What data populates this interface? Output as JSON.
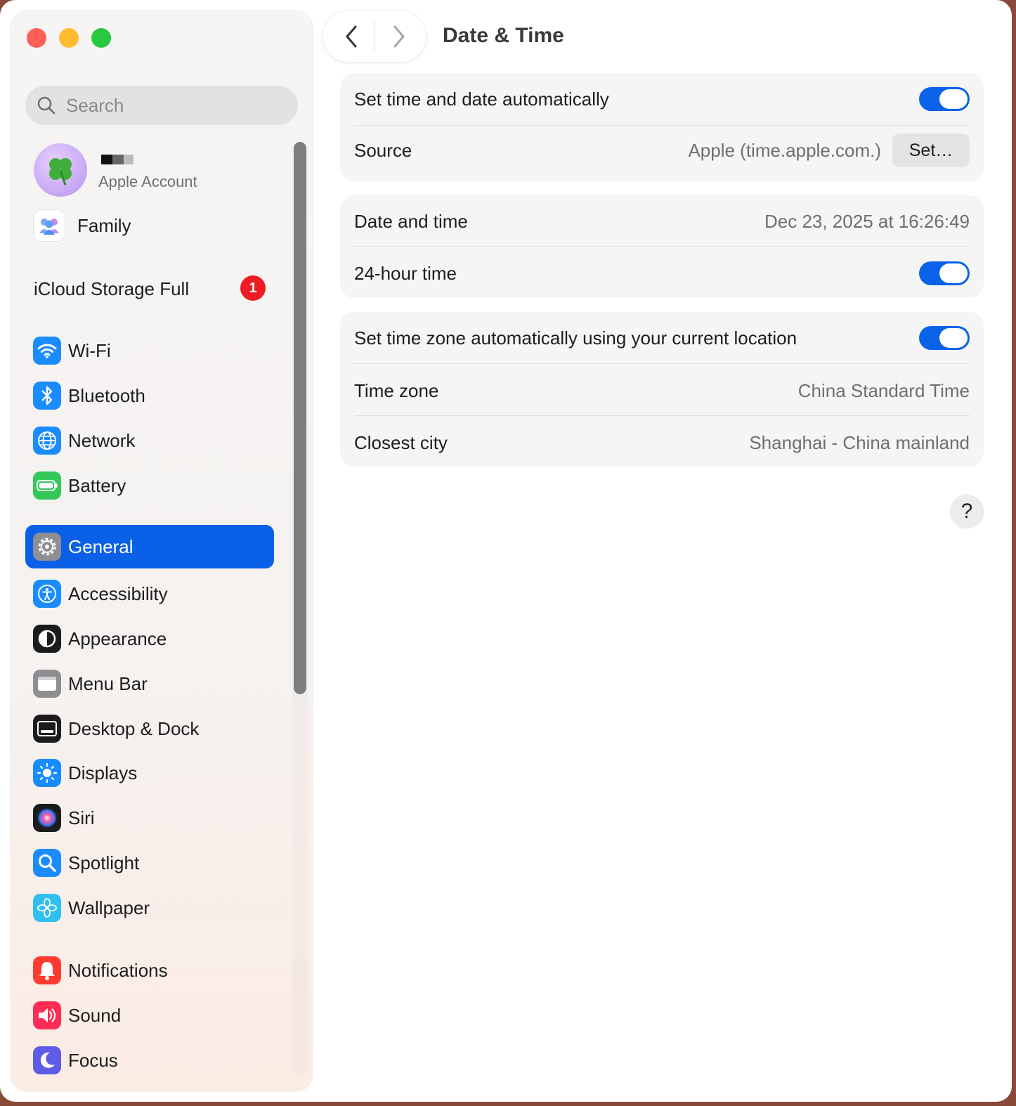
{
  "window": {
    "title": "Date & Time"
  },
  "sidebar": {
    "search_placeholder": "Search",
    "account": {
      "subtitle": "Apple Account",
      "avatar_icon": "four-leaf-clover"
    },
    "family_label": "Family",
    "icloud": {
      "label": "iCloud Storage Full",
      "badge": "1"
    },
    "items": [
      {
        "label": "Wi-Fi",
        "icon": "wifi-icon",
        "color": "#1a8cff"
      },
      {
        "label": "Bluetooth",
        "icon": "bluetooth-icon",
        "color": "#1a8cff"
      },
      {
        "label": "Network",
        "icon": "globe-icon",
        "color": "#1a8cff"
      },
      {
        "label": "Battery",
        "icon": "battery-icon",
        "color": "#34c759"
      },
      {
        "label": "General",
        "icon": "gear-icon",
        "color": "#8e8e93",
        "selected": true
      },
      {
        "label": "Accessibility",
        "icon": "accessibility-icon",
        "color": "#1a8cff"
      },
      {
        "label": "Appearance",
        "icon": "appearance-icon",
        "color": "#1c1c1e"
      },
      {
        "label": "Menu Bar",
        "icon": "menu-bar-icon",
        "color": "#8e8e93"
      },
      {
        "label": "Desktop & Dock",
        "icon": "dock-icon",
        "color": "#1c1c1e"
      },
      {
        "label": "Displays",
        "icon": "sun-icon",
        "color": "#1a8cff"
      },
      {
        "label": "Siri",
        "icon": "siri-icon",
        "color": "#1c1c1e"
      },
      {
        "label": "Spotlight",
        "icon": "magnifier-icon",
        "color": "#1a8cff"
      },
      {
        "label": "Wallpaper",
        "icon": "flower-icon",
        "color": "#2fc0f0"
      },
      {
        "label": "Notifications",
        "icon": "bell-icon",
        "color": "#ff3b30"
      },
      {
        "label": "Sound",
        "icon": "speaker-icon",
        "color": "#ff2d55"
      },
      {
        "label": "Focus",
        "icon": "moon-icon",
        "color": "#5e5ce6"
      }
    ]
  },
  "content": {
    "auto_time": {
      "label": "Set time and date automatically",
      "on": true
    },
    "source": {
      "label": "Source",
      "value": "Apple (time.apple.com.)",
      "button": "Set…"
    },
    "date_time": {
      "label": "Date and time",
      "value": "Dec 23, 2025 at 16:26:49"
    },
    "hour24": {
      "label": "24-hour time",
      "on": true
    },
    "auto_tz": {
      "label": "Set time zone automatically using your current location",
      "on": true
    },
    "time_zone": {
      "label": "Time zone",
      "value": "China Standard Time"
    },
    "closest_city": {
      "label": "Closest city",
      "value": "Shanghai - China mainland"
    },
    "help": "?"
  }
}
